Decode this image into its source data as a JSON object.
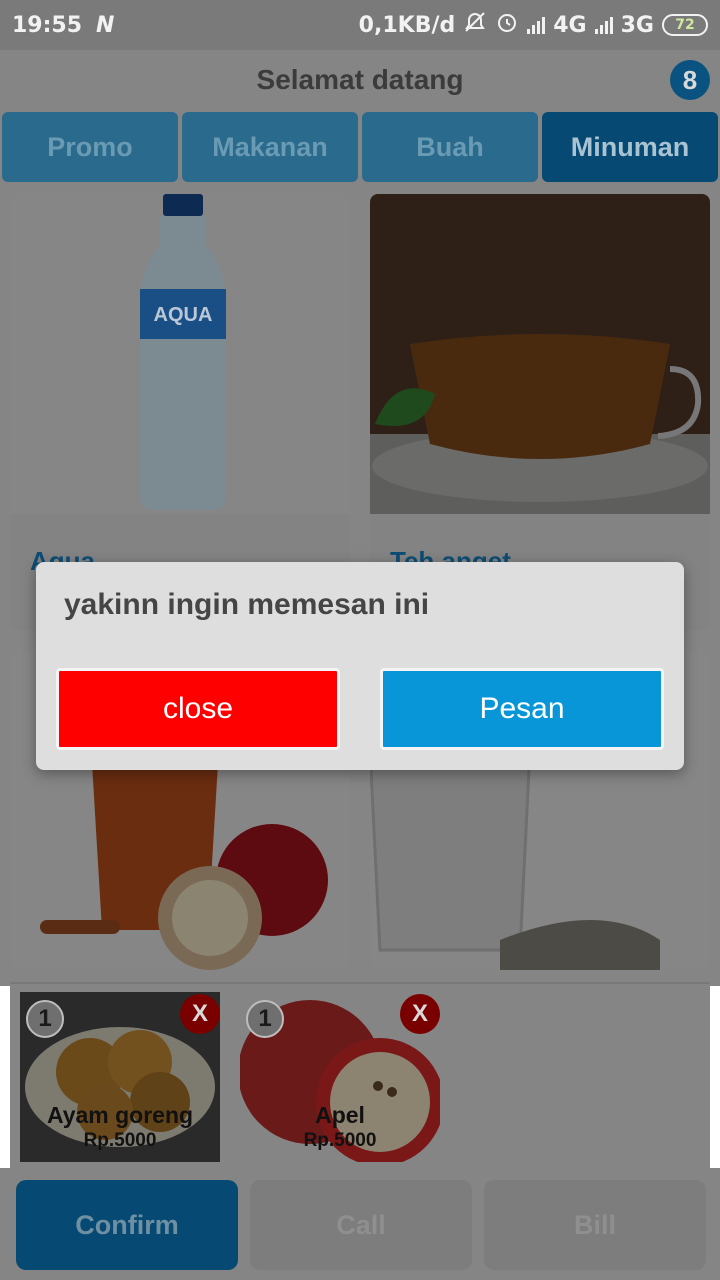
{
  "status_bar": {
    "time": "19:55",
    "notification_glyph": "N",
    "net_speed": "0,1KB/d",
    "network1": "4G",
    "network2": "3G",
    "battery": "72"
  },
  "header": {
    "title": "Selamat datang",
    "cart_count": "8"
  },
  "tabs": [
    {
      "label": "Promo",
      "active": false
    },
    {
      "label": "Makanan",
      "active": false
    },
    {
      "label": "Buah",
      "active": false
    },
    {
      "label": "Minuman",
      "active": true
    }
  ],
  "products": [
    {
      "name": "Aqua",
      "image": "water-bottle"
    },
    {
      "name": "Teh anget",
      "image": "hot-tea"
    },
    {
      "name": "",
      "image": "apple-juice"
    },
    {
      "name": "",
      "image": "glass-of-water"
    }
  ],
  "orders": [
    {
      "qty": "1",
      "name": "Ayam goreng",
      "price": "Rp.5000",
      "remove": "X",
      "image": "fried-chicken"
    },
    {
      "qty": "1",
      "name": "Apel",
      "price": "Rp.5000",
      "remove": "X",
      "image": "apple"
    }
  ],
  "bottom_bar": {
    "confirm": "Confirm",
    "call": "Call",
    "bill": "Bill"
  },
  "dialog": {
    "message": "yakinn ingin memesan ini",
    "close_label": "close",
    "order_label": "Pesan"
  },
  "colors": {
    "accent": "#0896d8",
    "danger": "#ff0000",
    "tab_active": "#064a74"
  }
}
